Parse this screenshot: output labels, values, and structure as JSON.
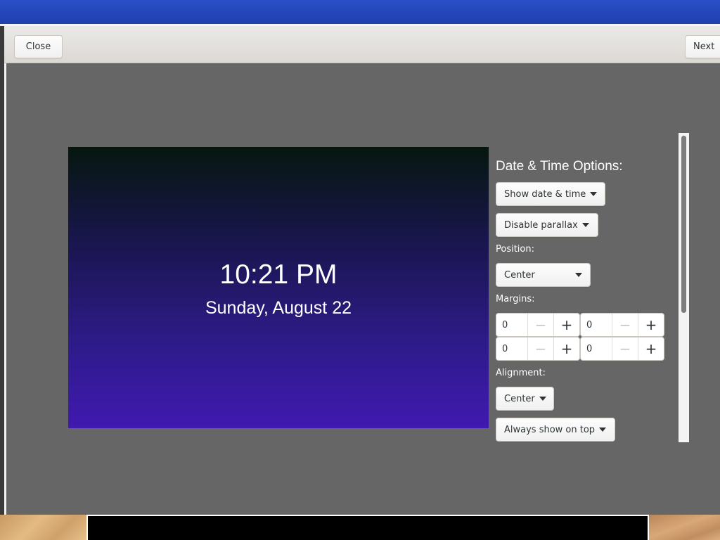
{
  "header": {
    "close_label": "Close",
    "next_label": "Next"
  },
  "preview": {
    "time": "10:21 PM",
    "date": "Sunday, August 22"
  },
  "options": {
    "heading": "Date & Time Options:",
    "show_date_time": "Show date & time",
    "parallax": "Disable parallax",
    "position_label": "Position:",
    "position_value": "Center",
    "margins_label": "Margins:",
    "margins": [
      "0",
      "0",
      "0",
      "0"
    ],
    "minus_glyph": "−",
    "plus_glyph": "+",
    "alignment_label": "Alignment:",
    "alignment_value": "Center",
    "always_on_top": "Always show on top"
  },
  "colors": {
    "dialog_bg": "#666666",
    "header_bg": "#e3e1de",
    "topbar": "#2447bd",
    "preview_top": "#06170f",
    "preview_bottom": "#4019b0"
  }
}
